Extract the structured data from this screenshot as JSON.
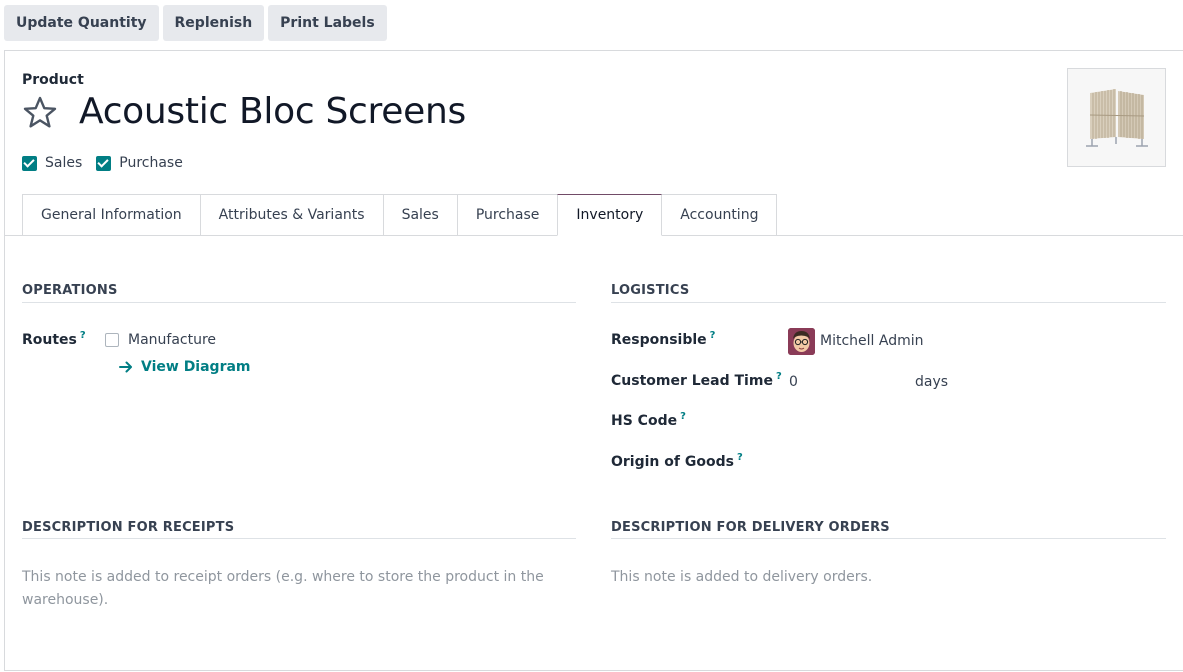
{
  "toolbar": {
    "update_quantity": "Update Quantity",
    "replenish": "Replenish",
    "print_labels": "Print Labels"
  },
  "product": {
    "label": "Product",
    "name": "Acoustic Bloc Screens",
    "can_be_sold_label": "Sales",
    "can_be_sold": true,
    "can_be_purchased_label": "Purchase",
    "can_be_purchased": true
  },
  "tabs": [
    {
      "label": "General Information",
      "active": false
    },
    {
      "label": "Attributes & Variants",
      "active": false
    },
    {
      "label": "Sales",
      "active": false
    },
    {
      "label": "Purchase",
      "active": false
    },
    {
      "label": "Inventory",
      "active": true
    },
    {
      "label": "Accounting",
      "active": false
    }
  ],
  "operations": {
    "title": "OPERATIONS",
    "routes_label": "Routes",
    "help": "?",
    "route_manufacture": "Manufacture",
    "route_manufacture_checked": false,
    "view_diagram": "View Diagram"
  },
  "logistics": {
    "title": "LOGISTICS",
    "responsible_label": "Responsible",
    "responsible_value": "Mitchell Admin",
    "lead_time_label": "Customer Lead Time",
    "lead_time_value": "0",
    "lead_time_unit": "days",
    "hs_code_label": "HS Code",
    "origin_label": "Origin of Goods",
    "help": "?"
  },
  "receipts": {
    "title": "DESCRIPTION FOR RECEIPTS",
    "placeholder": "This note is added to receipt orders (e.g. where to store the product in the warehouse)."
  },
  "delivery": {
    "title": "DESCRIPTION FOR DELIVERY ORDERS",
    "placeholder": "This note is added to delivery orders."
  },
  "colors": {
    "accent": "#017e84",
    "tab_active_border": "#714b67"
  }
}
